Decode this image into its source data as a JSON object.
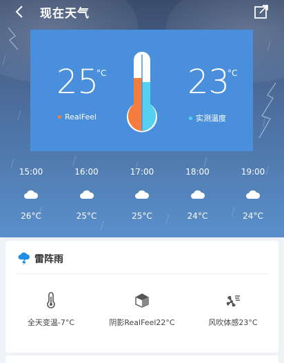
{
  "header": {
    "title": "现在天气"
  },
  "thermometer": {
    "realfeel_value": "25",
    "realfeel_label": "RealFeel",
    "measured_value": "23",
    "measured_label": "实测温度",
    "degree_symbol": "°C",
    "realfeel_color": "#f47c3c",
    "measured_color": "#56d0f0"
  },
  "forecast": [
    {
      "time": "15:00",
      "icon": "cloud-icon",
      "temp": "26°C"
    },
    {
      "time": "16:00",
      "icon": "cloud-icon",
      "temp": "25°C"
    },
    {
      "time": "17:00",
      "icon": "cloud-icon",
      "temp": "25°C"
    },
    {
      "time": "18:00",
      "icon": "cloud-icon",
      "temp": "24°C"
    },
    {
      "time": "19:00",
      "icon": "cloud-icon",
      "temp": "24°C"
    }
  ],
  "panel": {
    "condition": "雷阵雨",
    "condition_icon": "thunderstorm-icon",
    "stats": [
      {
        "icon": "thermometer-icon",
        "label": "全天变温-7°C"
      },
      {
        "icon": "shade-icon",
        "label": "阴影RealFeel22°C"
      },
      {
        "icon": "wind-chill-icon",
        "label": "风吹体感23°C"
      }
    ]
  },
  "colors": {
    "card_bg": "#4a8fdb",
    "accent_blue": "#1f8fe5"
  }
}
